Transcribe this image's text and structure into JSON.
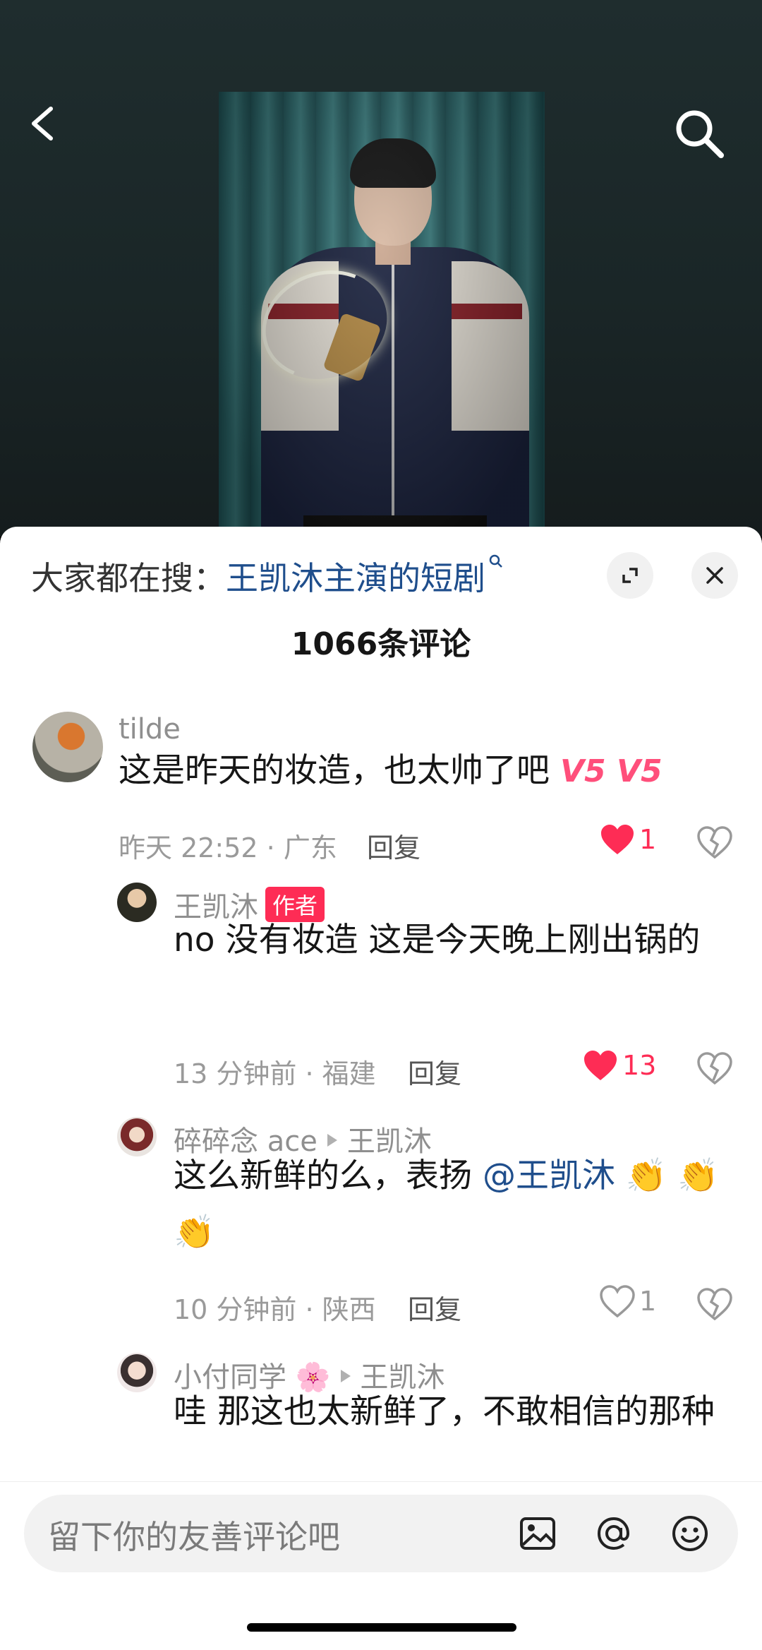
{
  "video": {
    "back_icon": "chevron-left-icon",
    "search_icon": "search-icon"
  },
  "header": {
    "search_prefix": "大家都在搜：",
    "search_link": "王凯沐主演的短剧",
    "expand_icon": "expand-icon",
    "close_icon": "close-icon",
    "comment_count": "1066条评论"
  },
  "comments": [
    {
      "user": "tilde",
      "text": "这是昨天的妆造，也太帅了吧",
      "emoji": "V5 V5",
      "time_location": "昨天 22:52 · 广东",
      "reply_label": "回复",
      "likes": "1",
      "liked": true
    },
    {
      "user": "王凯沐",
      "author_tag": "作者",
      "text": "no 没有妆造 这是今天晚上刚出锅的",
      "time_location": "13 分钟前 · 福建",
      "reply_label": "回复",
      "likes": "13",
      "liked": true
    },
    {
      "user": "碎碎念 ace",
      "reply_to": "王凯沐",
      "text": "这么新鲜的么，表扬",
      "mention": "@王凯沐",
      "emoji": "👏 👏👏",
      "time_location": "10 分钟前 · 陕西",
      "reply_label": "回复",
      "likes": "1",
      "liked": false
    },
    {
      "user": "小付同学 🌸",
      "reply_to": "王凯沐",
      "text": "哇 那这也太新鲜了，不敢相信的那种"
    }
  ],
  "input": {
    "placeholder": "留下你的友善评论吧",
    "image_icon": "image-icon",
    "at_icon": "at-icon",
    "emoji_icon": "emoji-icon"
  },
  "colors": {
    "accent_like": "#fe2c55",
    "link": "#1f4e8c"
  }
}
